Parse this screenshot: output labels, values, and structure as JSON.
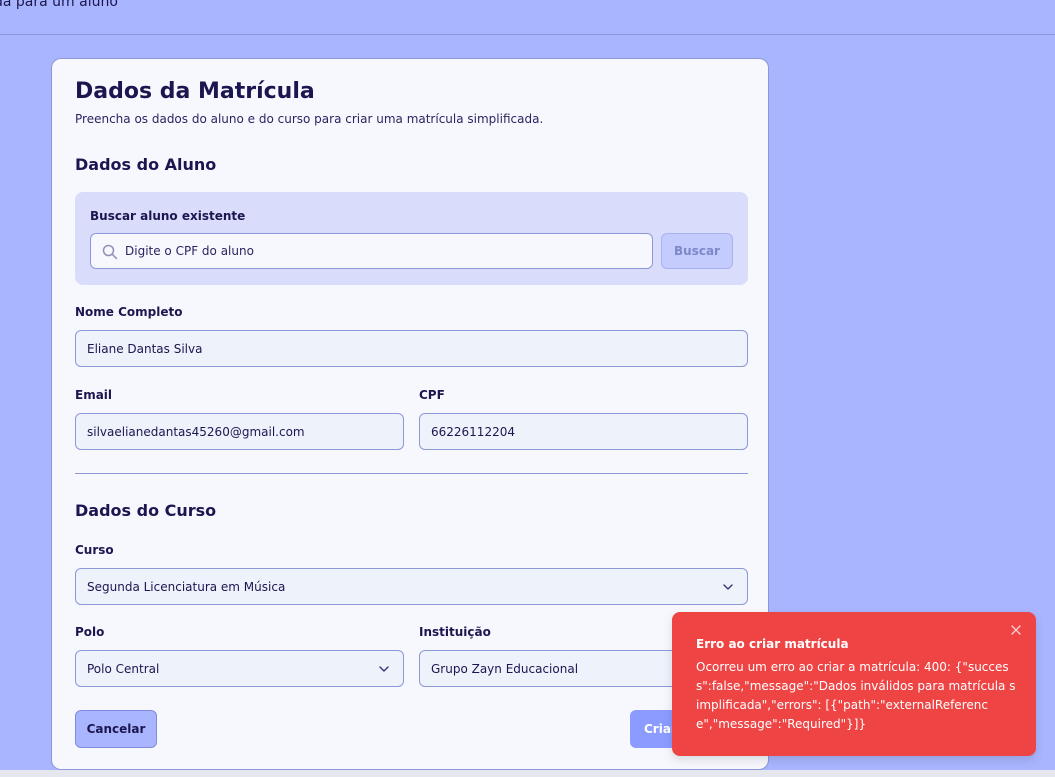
{
  "header": {
    "text": "da para um aluno"
  },
  "card": {
    "title": "Dados da Matrícula",
    "subtitle": "Preencha os dados do aluno e do curso para criar uma matrícula simplificada."
  },
  "student": {
    "section_title": "Dados do Aluno",
    "search": {
      "label": "Buscar aluno existente",
      "placeholder": "Digite o CPF do aluno",
      "button_label": "Buscar",
      "icon": "search-icon"
    },
    "name": {
      "label": "Nome Completo",
      "value": "Eliane Dantas Silva"
    },
    "email": {
      "label": "Email",
      "value": "silvaelianedantas45260@gmail.com"
    },
    "cpf": {
      "label": "CPF",
      "value": "66226112204"
    }
  },
  "course": {
    "section_title": "Dados do Curso",
    "course": {
      "label": "Curso",
      "selected": "Segunda Licenciatura em Música"
    },
    "polo": {
      "label": "Polo",
      "selected": "Polo Central"
    },
    "institution": {
      "label": "Instituição",
      "selected": "Grupo Zayn Educacional"
    }
  },
  "actions": {
    "cancel_label": "Cancelar",
    "create_label": "Criar"
  },
  "toast": {
    "title": "Erro ao criar matrícula",
    "message": "Ocorreu um erro ao criar a matrícula: 400: {\"success\":false,\"message\":\"Dados inválidos para matrícula simplificada\",\"errors\": [{\"path\":\"externalReference\",\"message\":\"Required\"}]}",
    "close_icon": "close-icon"
  },
  "colors": {
    "background": "#a9b6ff",
    "card": "#f7f8fe",
    "primary": "#8b9bff",
    "error": "#ef4444",
    "text": "#1c1650"
  }
}
